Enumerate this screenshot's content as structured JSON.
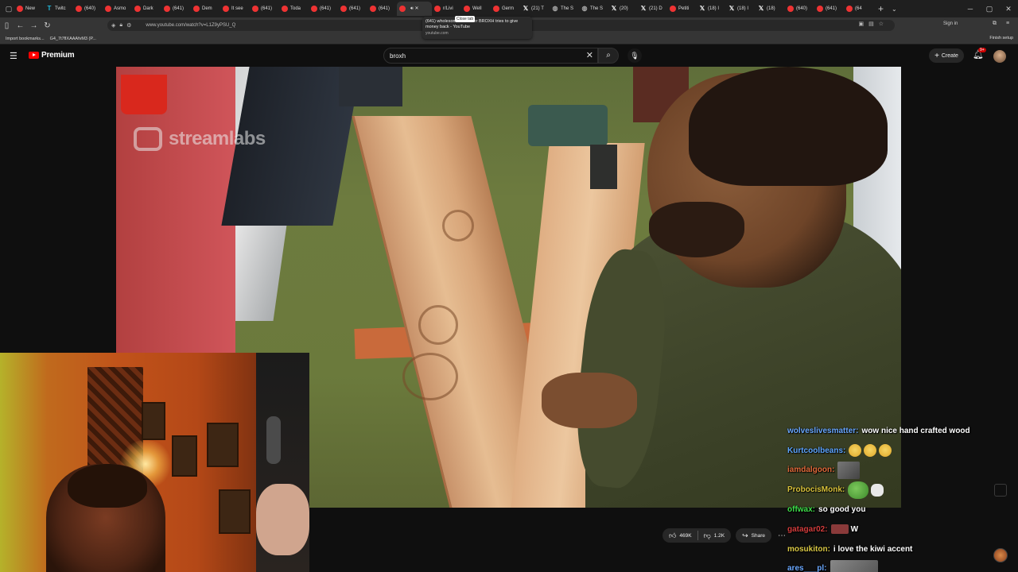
{
  "browser": {
    "tabs": [
      {
        "icon": "youtube",
        "label": "New"
      },
      {
        "icon": "twitch",
        "label": "Twitc"
      },
      {
        "icon": "youtube",
        "label": "(640)"
      },
      {
        "icon": "youtube",
        "label": "Asmo"
      },
      {
        "icon": "youtube",
        "label": "Dark"
      },
      {
        "icon": "youtube",
        "label": "(641)"
      },
      {
        "icon": "youtube",
        "label": "Dem"
      },
      {
        "icon": "youtube",
        "label": "It see"
      },
      {
        "icon": "youtube",
        "label": "(641)"
      },
      {
        "icon": "youtube",
        "label": "Toda"
      },
      {
        "icon": "youtube",
        "label": "(641)"
      },
      {
        "icon": "youtube",
        "label": "(641)"
      },
      {
        "icon": "youtube",
        "label": "(641)"
      },
      {
        "icon": "youtube",
        "label": "",
        "active": true
      },
      {
        "icon": "youtube",
        "label": "r/Livi"
      },
      {
        "icon": "youtube",
        "label": "Well"
      },
      {
        "icon": "youtube",
        "label": "Germ"
      },
      {
        "icon": "x",
        "label": "(21) T"
      },
      {
        "icon": "generic",
        "label": "The S"
      },
      {
        "icon": "generic",
        "label": "The S"
      },
      {
        "icon": "x",
        "label": "(20)"
      },
      {
        "icon": "x",
        "label": "(21) D"
      },
      {
        "icon": "youtube",
        "label": "Petiti"
      },
      {
        "icon": "x",
        "label": "(18) I"
      },
      {
        "icon": "x",
        "label": "(18) I"
      },
      {
        "icon": "x",
        "label": "(18)"
      },
      {
        "icon": "youtube",
        "label": "(640)"
      },
      {
        "icon": "youtube",
        "label": "(641)"
      },
      {
        "icon": "youtube",
        "label": "(64"
      }
    ],
    "new_tab": "+",
    "tooltip": {
      "close_label": "Close tab",
      "title": "(641) wholesome streamer BROXH tries to give money back - YouTube",
      "url": "youtube.com"
    },
    "address": "www.youtube.com/watch?v=L1Z9yPSU_Q",
    "sign_in": "Sign in",
    "bookmarks": [
      {
        "label": "Import bookmarks..."
      },
      {
        "label": "G4_7t7flXAAAfvM3 (P..."
      }
    ],
    "finish_setup": "Finish setup"
  },
  "youtube": {
    "logo": "Premium",
    "search_query": "broxh",
    "create_label": "Create",
    "notification_badge": "9+"
  },
  "video": {
    "watermark": "streamlabs"
  },
  "actions": {
    "likes": "469K",
    "dislikes": "1.2K",
    "share": "Share"
  },
  "chat": [
    {
      "user": "wolveslivesmatter",
      "color": "#6aa8ff",
      "text": "wow nice hand crafted wood",
      "emotes": []
    },
    {
      "user": "Kurtcoolbeans",
      "color": "#5ea6ff",
      "text": "",
      "emotes": [
        "smile",
        "smile",
        "smile"
      ]
    },
    {
      "user": "iamdalgoon",
      "color": "#e06a3a",
      "text": "",
      "emotes": [
        "img"
      ]
    },
    {
      "user": "ProbocisMonk",
      "color": "#d8c23a",
      "text": "",
      "emotes": [
        "frog",
        "hand"
      ]
    },
    {
      "user": "offwax",
      "color": "#3fe04a",
      "text": "so good you",
      "emotes": []
    },
    {
      "user": "gatagar02",
      "color": "#d23c3c",
      "text": "W",
      "emotes": [
        "red"
      ]
    },
    {
      "user": "mosukiton",
      "color": "#d9c845",
      "text": "i love the kiwi accent",
      "emotes": []
    },
    {
      "user": "ares___pl",
      "color": "#6aa8ff",
      "text": "",
      "emotes": [
        "bigimg"
      ]
    }
  ],
  "colors": {
    "accent": "#ff0000",
    "bg": "#0f0f0f"
  }
}
